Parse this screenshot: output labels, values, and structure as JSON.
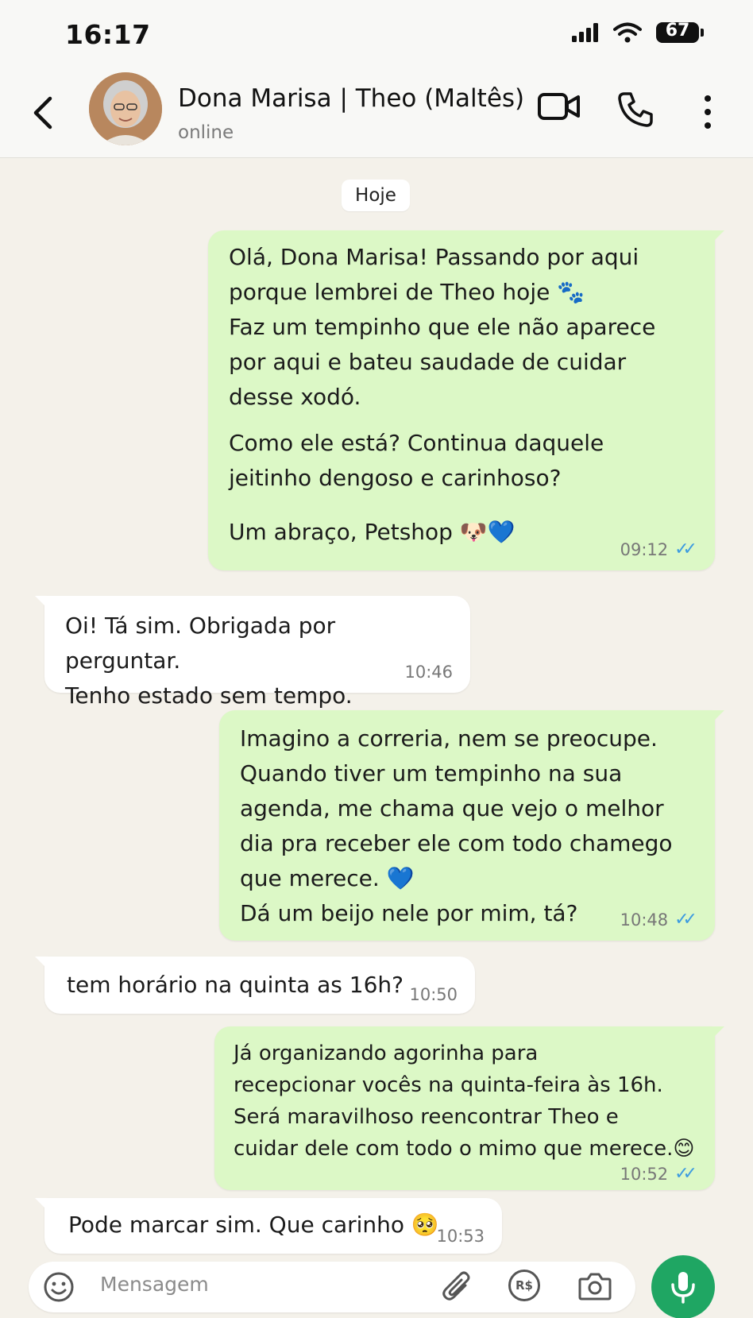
{
  "status_bar": {
    "time": "16:17",
    "battery": "67"
  },
  "header": {
    "contact_name": "Dona Marisa | Theo (Maltês)",
    "contact_status": "online"
  },
  "date_divider": "Hoje",
  "messages": [
    {
      "direction": "outgoing",
      "paragraphs": [
        "Olá, Dona Marisa! Passando por aqui\nporque lembrei de Theo hoje 🐾\nFaz um tempinho que ele não aparece\npor aqui e bateu saudade de cuidar\ndesse xodó.",
        "Como ele está? Continua daquele\njeitinho dengoso e carinhoso?",
        "Um abraço, Petshop 🐶💙"
      ],
      "time": "09:12",
      "status": "read"
    },
    {
      "direction": "incoming",
      "paragraphs": [
        "Oi! Tá sim. Obrigada por perguntar.\nTenho estado sem tempo."
      ],
      "time": "10:46"
    },
    {
      "direction": "outgoing",
      "paragraphs": [
        "Imagino a correria, nem se preocupe.\nQuando tiver um tempinho na sua\nagenda, me chama que vejo o melhor\ndia pra receber ele com todo chamego\nque merece. 💙\nDá um beijo nele por mim, tá?"
      ],
      "time": "10:48",
      "status": "read"
    },
    {
      "direction": "incoming",
      "paragraphs": [
        "tem horário na quinta as 16h?"
      ],
      "time": "10:50"
    },
    {
      "direction": "outgoing",
      "paragraphs": [
        "Já organizando agorinha para\nrecepcionar vocês na quinta-feira às 16h.\nSerá maravilhoso reencontrar Theo e\ncuidar dele com todo o mimo que merece.😊"
      ],
      "time": "10:52",
      "status": "read"
    },
    {
      "direction": "incoming",
      "paragraphs": [
        "Pode marcar sim. Que carinho 🥺"
      ],
      "time": "10:53"
    }
  ],
  "input": {
    "placeholder": "Mensagem",
    "pix_label": "R$"
  },
  "icons": {
    "back": "chevron-left-icon",
    "video": "video-camera-icon",
    "call": "phone-icon",
    "more": "vertical-dots-icon",
    "emoji": "smiley-icon",
    "attach": "paperclip-icon",
    "pix": "currency-icon",
    "camera": "camera-icon",
    "mic": "microphone-icon",
    "read_receipt": "double-check-icon"
  },
  "colors": {
    "outgoing_bubble": "#dcf8c6",
    "incoming_bubble": "#ffffff",
    "chat_background": "#f4f1ea",
    "read_ticks": "#3d9be0",
    "mic_button": "#1fa663"
  }
}
